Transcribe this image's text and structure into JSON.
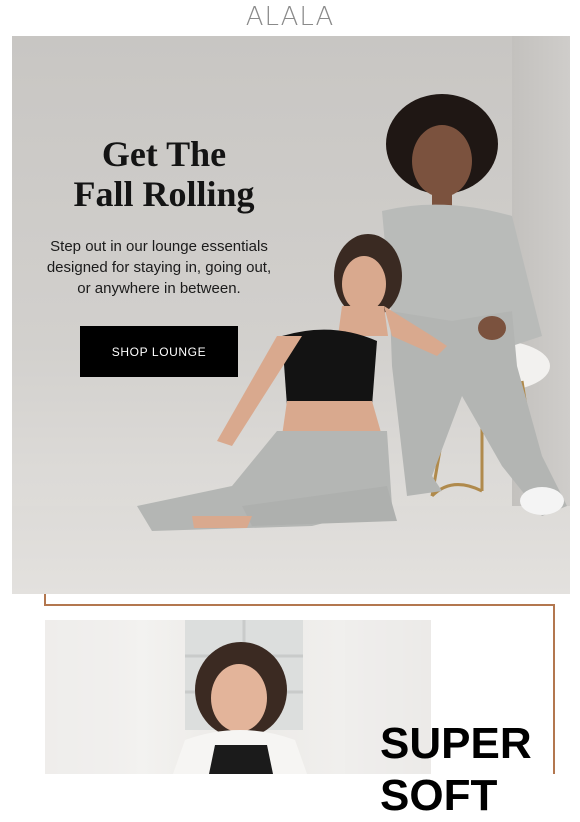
{
  "brand": {
    "logo_text": "ALALA"
  },
  "hero": {
    "title_lines": [
      "Get The",
      "Fall Rolling"
    ],
    "subtitle_lines": [
      "Step out in our lounge essentials",
      "designed for staying in, going out,",
      "or anywhere in between."
    ],
    "cta_label": "SHOP LOUNGE"
  },
  "section2": {
    "title_lines": [
      "SUPER",
      "SOFT"
    ]
  },
  "colors": {
    "accent_frame": "#b3774f",
    "button_bg": "#000000",
    "button_text": "#ffffff",
    "hero_bg": "#cfcdca"
  }
}
